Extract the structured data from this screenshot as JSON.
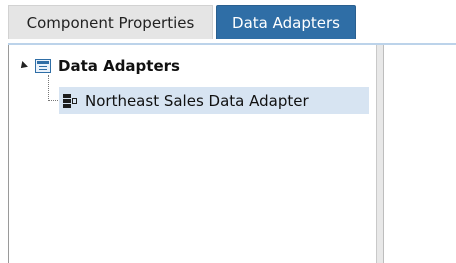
{
  "tabs": [
    {
      "label": "Component Properties",
      "active": false
    },
    {
      "label": "Data Adapters",
      "active": true
    }
  ],
  "tree": {
    "root": {
      "label": "Data Adapters",
      "expanded": true,
      "icon": "table-icon",
      "children": [
        {
          "label": "Northeast Sales Data Adapter",
          "icon": "data-adapter-icon",
          "selected": true
        }
      ]
    }
  },
  "colors": {
    "active_tab": "#2f6ea6",
    "selected_row": "#d7e4f2"
  }
}
